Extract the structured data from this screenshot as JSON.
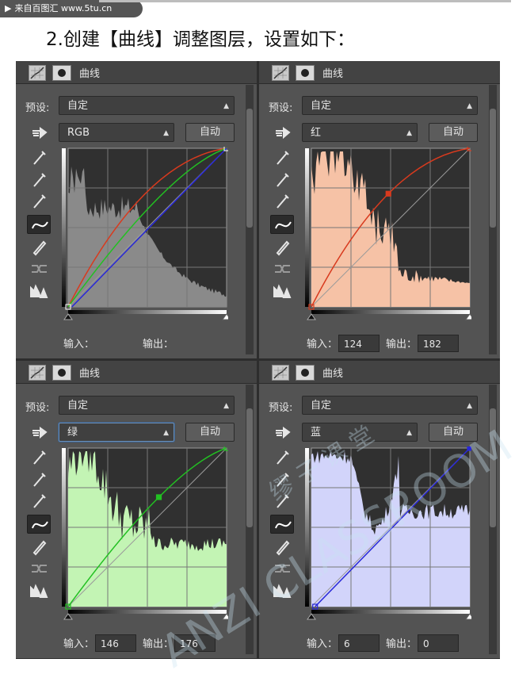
{
  "site_badge": {
    "text": "来自百图汇  www.5tu.cn"
  },
  "heading": "2.创建【曲线】调整图层，设置如下：",
  "panels": [
    {
      "title": "曲线",
      "preset_label": "预设:",
      "preset_value": "自定",
      "channel": "RGB",
      "auto_label": "自动",
      "input_label": "输入：",
      "output_label": "输出：",
      "input_value": "",
      "output_value": "",
      "curve_color": "#cc2222",
      "hist_color": "#8a8a8a"
    },
    {
      "title": "曲线",
      "preset_label": "预设:",
      "preset_value": "自定",
      "channel": "红",
      "auto_label": "自动",
      "input_label": "输入：",
      "output_label": "输出：",
      "input_value": "124",
      "output_value": "182",
      "curve_color": "#d83a1e",
      "hist_color": "#f6c2a6"
    },
    {
      "title": "曲线",
      "preset_label": "预设:",
      "preset_value": "自定",
      "channel": "绿",
      "auto_label": "自动",
      "input_label": "输入：",
      "output_label": "输出：",
      "input_value": "146",
      "output_value": "176",
      "curve_color": "#22c022",
      "hist_color": "#c3f4b4"
    },
    {
      "title": "曲线",
      "preset_label": "预设:",
      "preset_value": "自定",
      "channel": "蓝",
      "auto_label": "自动",
      "input_label": "输入：",
      "output_label": "输出：",
      "input_value": "6",
      "output_value": "0",
      "curve_color": "#2828d8",
      "hist_color": "#d2d4fa"
    }
  ],
  "watermark": {
    "latin": "ANZI CLASSROOM",
    "cjk": "缪 子 课 堂"
  }
}
